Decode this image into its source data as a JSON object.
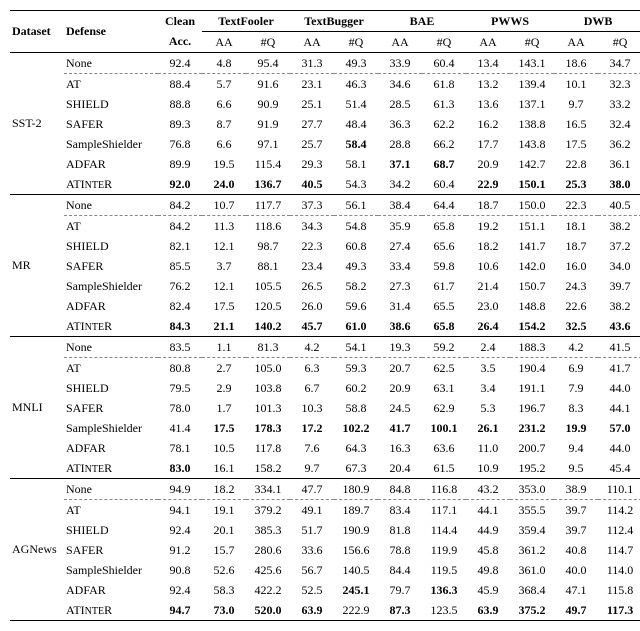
{
  "chart_data": {
    "type": "table",
    "header_top": {
      "dataset": "Dataset",
      "defense": "Defense",
      "clean": "Clean",
      "tf": "TextFooler",
      "tb": "TextBugger",
      "bae": "BAE",
      "pw": "PWWS",
      "dwb": "DWB"
    },
    "header_sub": {
      "acc": "Acc.",
      "aa": "AA",
      "nq": "#Q"
    },
    "datasets": [
      {
        "name": "SST-2",
        "rows": [
          {
            "defense": "None",
            "clean": "92.4",
            "v": [
              "4.8",
              "95.4",
              "31.3",
              "49.3",
              "33.9",
              "60.4",
              "13.4",
              "143.1",
              "18.6",
              "34.7"
            ],
            "dashed_after": true
          },
          {
            "defense": "AT",
            "clean": "88.4",
            "v": [
              "5.7",
              "91.6",
              "23.1",
              "46.3",
              "34.6",
              "61.8",
              "13.2",
              "139.4",
              "10.1",
              "32.3"
            ]
          },
          {
            "defense": "SHIELD",
            "clean": "88.8",
            "v": [
              "6.6",
              "90.9",
              "25.1",
              "51.4",
              "28.5",
              "61.3",
              "13.6",
              "137.1",
              "9.7",
              "33.2"
            ]
          },
          {
            "defense": "SAFER",
            "clean": "89.3",
            "v": [
              "8.7",
              "91.9",
              "27.7",
              "48.4",
              "36.3",
              "62.2",
              "16.2",
              "138.8",
              "16.5",
              "32.4"
            ]
          },
          {
            "defense": "SampleShielder",
            "clean": "76.8",
            "v": [
              "6.6",
              "97.1",
              "25.7",
              {
                "t": "58.4",
                "b": true
              },
              "28.8",
              "66.2",
              "17.7",
              "143.8",
              "17.5",
              "36.2"
            ]
          },
          {
            "defense": "ADFAR",
            "clean": "89.9",
            "v": [
              "19.5",
              "115.4",
              "29.3",
              "58.1",
              {
                "t": "37.1",
                "b": true
              },
              {
                "t": "68.7",
                "b": true
              },
              "20.9",
              "142.7",
              "22.8",
              "36.1"
            ]
          },
          {
            "defense": {
              "t": "ATInteR",
              "sc": true
            },
            "clean": {
              "t": "92.0",
              "b": true
            },
            "v": [
              {
                "t": "24.0",
                "b": true
              },
              {
                "t": "136.7",
                "b": true
              },
              {
                "t": "40.5",
                "b": true
              },
              "54.3",
              "34.2",
              "60.4",
              {
                "t": "22.9",
                "b": true
              },
              {
                "t": "150.1",
                "b": true
              },
              {
                "t": "25.3",
                "b": true
              },
              {
                "t": "38.0",
                "b": true
              }
            ]
          }
        ]
      },
      {
        "name": "MR",
        "rows": [
          {
            "defense": "None",
            "clean": "84.2",
            "v": [
              "10.7",
              "117.7",
              "37.3",
              "56.1",
              "38.4",
              "64.4",
              "18.7",
              "150.0",
              "22.3",
              "40.5"
            ],
            "dashed_after": true
          },
          {
            "defense": "AT",
            "clean": "84.2",
            "v": [
              "11.3",
              "118.6",
              "34.3",
              "54.8",
              "35.9",
              "65.8",
              "19.2",
              "151.1",
              "18.1",
              "38.2"
            ]
          },
          {
            "defense": "SHIELD",
            "clean": "82.1",
            "v": [
              "12.1",
              "98.7",
              "22.3",
              "60.8",
              "27.4",
              "65.6",
              "18.2",
              "141.7",
              "18.7",
              "37.2"
            ]
          },
          {
            "defense": "SAFER",
            "clean": "85.5",
            "v": [
              "3.7",
              "88.1",
              "23.4",
              "49.3",
              "33.4",
              "59.8",
              "10.6",
              "142.0",
              "16.0",
              "34.0"
            ]
          },
          {
            "defense": "SampleShielder",
            "clean": "76.2",
            "v": [
              "12.1",
              "105.5",
              "26.5",
              "58.2",
              "27.3",
              "61.7",
              "21.4",
              "150.7",
              "24.3",
              "39.7"
            ]
          },
          {
            "defense": "ADFAR",
            "clean": "82.4",
            "v": [
              "17.5",
              "120.5",
              "26.0",
              "59.6",
              "31.4",
              "65.5",
              "23.0",
              "148.8",
              "22.6",
              "38.2"
            ]
          },
          {
            "defense": {
              "t": "ATInteR",
              "sc": true
            },
            "clean": {
              "t": "84.3",
              "b": true
            },
            "v": [
              {
                "t": "21.1",
                "b": true
              },
              {
                "t": "140.2",
                "b": true
              },
              {
                "t": "45.7",
                "b": true
              },
              {
                "t": "61.0",
                "b": true
              },
              {
                "t": "38.6",
                "b": true
              },
              {
                "t": "65.8",
                "b": true
              },
              {
                "t": "26.4",
                "b": true
              },
              {
                "t": "154.2",
                "b": true
              },
              {
                "t": "32.5",
                "b": true
              },
              {
                "t": "43.6",
                "b": true
              }
            ]
          }
        ]
      },
      {
        "name": "MNLI",
        "rows": [
          {
            "defense": "None",
            "clean": "83.5",
            "v": [
              "1.1",
              "81.3",
              "4.2",
              "54.1",
              "19.3",
              "59.2",
              "2.4",
              "188.3",
              "4.2",
              "41.5"
            ],
            "dashed_after": true
          },
          {
            "defense": "AT",
            "clean": "80.8",
            "v": [
              "2.7",
              "105.0",
              "6.3",
              "59.3",
              "20.7",
              "62.5",
              "3.5",
              "190.4",
              "6.9",
              "41.7"
            ]
          },
          {
            "defense": "SHIELD",
            "clean": "79.5",
            "v": [
              "2.9",
              "103.8",
              "6.7",
              "60.2",
              "20.9",
              "63.1",
              "3.4",
              "191.1",
              "7.9",
              "44.0"
            ]
          },
          {
            "defense": "SAFER",
            "clean": "78.0",
            "v": [
              "1.7",
              "101.3",
              "10.3",
              "58.8",
              "24.5",
              "62.9",
              "5.3",
              "196.7",
              "8.3",
              "44.1"
            ]
          },
          {
            "defense": "SampleShielder",
            "clean": "41.4",
            "v": [
              {
                "t": "17.5",
                "b": true
              },
              {
                "t": "178.3",
                "b": true
              },
              {
                "t": "17.2",
                "b": true
              },
              {
                "t": "102.2",
                "b": true
              },
              {
                "t": "41.7",
                "b": true
              },
              {
                "t": "100.1",
                "b": true
              },
              {
                "t": "26.1",
                "b": true
              },
              {
                "t": "231.2",
                "b": true
              },
              {
                "t": "19.9",
                "b": true
              },
              {
                "t": "57.0",
                "b": true
              }
            ]
          },
          {
            "defense": "ADFAR",
            "clean": "78.1",
            "v": [
              "10.5",
              "117.8",
              "7.6",
              "64.3",
              "16.3",
              "63.6",
              "11.0",
              "200.7",
              "9.4",
              "44.0"
            ]
          },
          {
            "defense": {
              "t": "ATInteR",
              "sc": true
            },
            "clean": {
              "t": "83.0",
              "b": true
            },
            "v": [
              "16.1",
              "158.2",
              "9.7",
              "67.3",
              "20.4",
              "61.5",
              "10.9",
              "195.2",
              "9.5",
              "45.4"
            ]
          }
        ]
      },
      {
        "name": "AGNews",
        "rows": [
          {
            "defense": "None",
            "clean": "94.9",
            "v": [
              "18.2",
              "334.1",
              "47.7",
              "180.9",
              "84.8",
              "116.8",
              "43.2",
              "353.0",
              "38.9",
              "110.1"
            ],
            "dashed_after": true
          },
          {
            "defense": "AT",
            "clean": "94.1",
            "v": [
              "19.1",
              "379.2",
              "49.1",
              "189.7",
              "83.4",
              "117.1",
              "44.1",
              "355.5",
              "39.7",
              "114.2"
            ]
          },
          {
            "defense": "SHIELD",
            "clean": "92.4",
            "v": [
              "20.1",
              "385.3",
              "51.7",
              "190.9",
              "81.8",
              "114.4",
              "44.9",
              "359.4",
              "39.7",
              "112.4"
            ]
          },
          {
            "defense": "SAFER",
            "clean": "91.2",
            "v": [
              "15.7",
              "280.6",
              "33.6",
              "156.6",
              "78.8",
              "119.9",
              "45.8",
              "361.2",
              "40.8",
              "114.7"
            ]
          },
          {
            "defense": "SampleShielder",
            "clean": "90.8",
            "v": [
              "52.6",
              "425.6",
              "56.7",
              "140.5",
              "84.4",
              "119.5",
              "49.8",
              "361.0",
              "40.0",
              "114.0"
            ]
          },
          {
            "defense": "ADFAR",
            "clean": "92.4",
            "v": [
              "58.3",
              "422.2",
              "52.5",
              {
                "t": "245.1",
                "b": true
              },
              "79.7",
              {
                "t": "136.3",
                "b": true
              },
              "45.9",
              "368.4",
              "47.1",
              "115.8"
            ]
          },
          {
            "defense": {
              "t": "ATInteR",
              "sc": true
            },
            "clean": {
              "t": "94.7",
              "b": true
            },
            "v": [
              {
                "t": "73.0",
                "b": true
              },
              {
                "t": "520.0",
                "b": true
              },
              {
                "t": "63.9",
                "b": true
              },
              "222.9",
              {
                "t": "87.3",
                "b": true
              },
              "123.5",
              {
                "t": "63.9",
                "b": true
              },
              {
                "t": "375.2",
                "b": true
              },
              {
                "t": "49.7",
                "b": true
              },
              {
                "t": "117.3",
                "b": true
              }
            ]
          }
        ]
      }
    ]
  }
}
